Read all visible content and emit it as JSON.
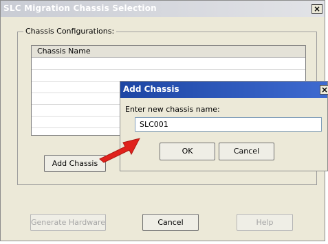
{
  "main_window": {
    "title": "SLC Migration Chassis Selection",
    "close_glyph": "×",
    "group_label": "Chassis Configurations:",
    "list_header": "Chassis Name",
    "add_chassis_label": "Add Chassis",
    "generate_hardware_label": "Generate Hardware",
    "cancel_label": "Cancel",
    "help_label": "Help"
  },
  "dialog": {
    "title": "Add Chassis",
    "close_glyph": "×",
    "prompt": "Enter new chassis name:",
    "input_value": "SLC001",
    "ok_label": "OK",
    "cancel_label": "Cancel"
  },
  "colors": {
    "arrow": "#e0221c",
    "dialog_title_bar": "#1d46a4"
  }
}
